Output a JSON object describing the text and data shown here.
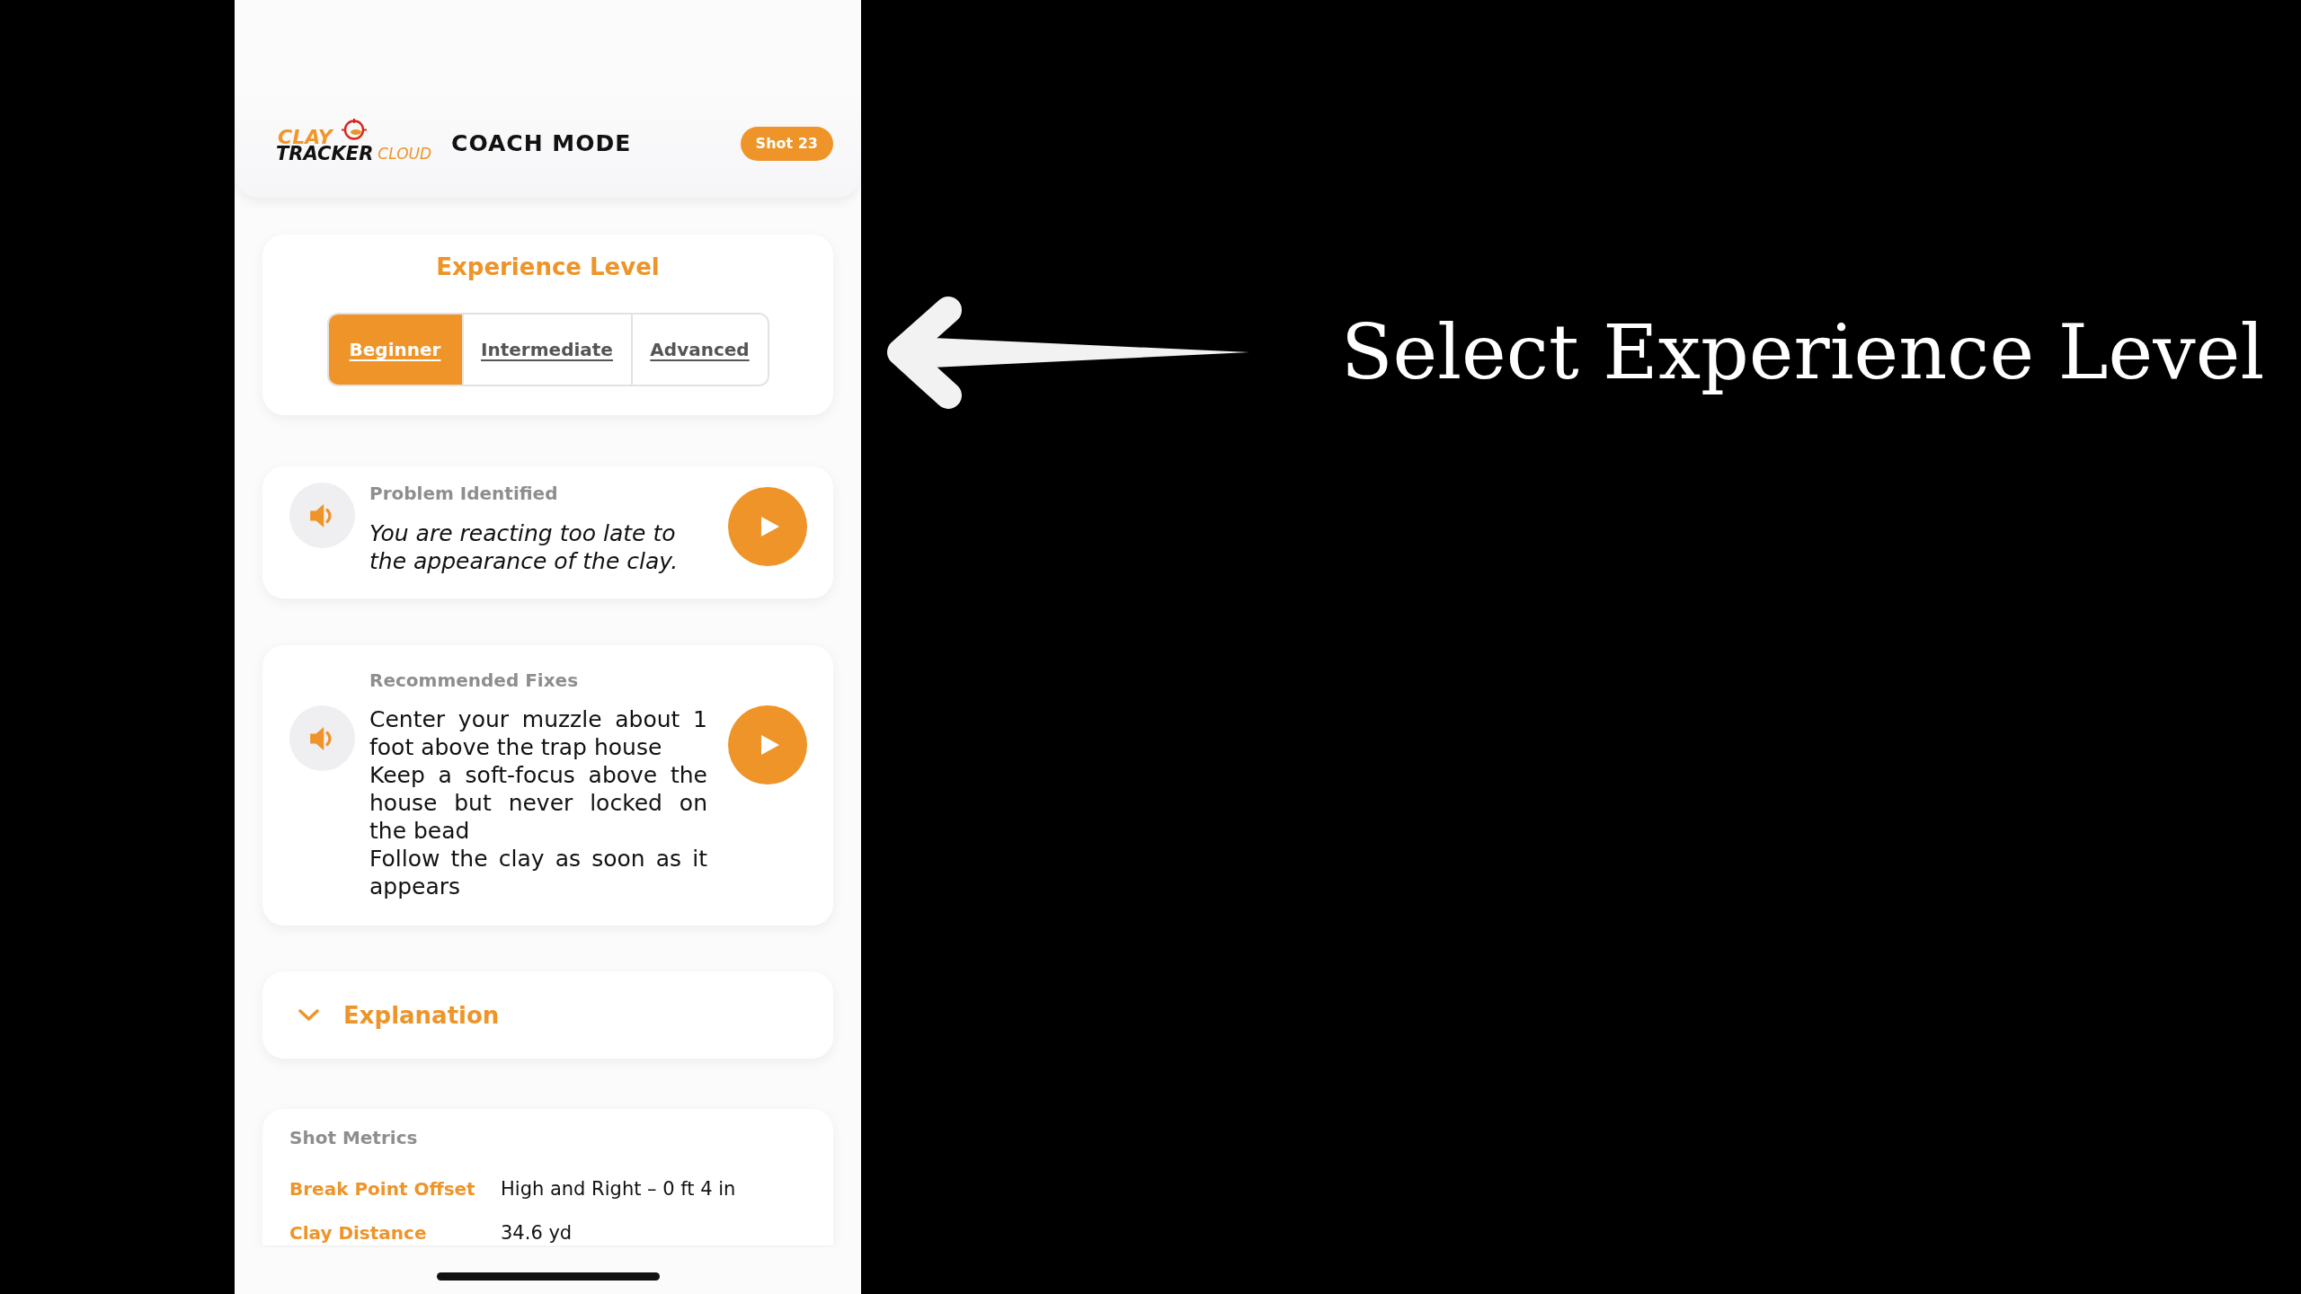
{
  "header": {
    "logo": {
      "line_1": "CLAY",
      "line_2": "TRACKER",
      "suffix": "CLOUD"
    },
    "title": "COACH MODE",
    "badge": "Shot 23"
  },
  "experience": {
    "title": "Experience Level",
    "levels": [
      {
        "label": "Beginner",
        "selected": true
      },
      {
        "label": "Intermediate",
        "selected": false
      },
      {
        "label": "Advanced",
        "selected": false
      }
    ]
  },
  "problem": {
    "label": "Problem Identified",
    "text": "You are reacting too late to the appearance of the clay."
  },
  "fixes": {
    "label": "Recommended Fixes",
    "items": [
      "Center your muzzle about 1 foot above the trap house",
      "Keep a soft-focus above the house but never locked on the bead",
      "Follow the clay as soon as it appears"
    ]
  },
  "explanation": {
    "title": "Explanation",
    "expanded": false
  },
  "shot_metrics": {
    "title": "Shot Metrics",
    "rows": [
      {
        "label": "Break Point Offset",
        "value": "High and Right – 0 ft 4 in"
      },
      {
        "label": "Clay Distance",
        "value": "34.6 yd"
      }
    ]
  },
  "callout": {
    "text": "Select Experience Level"
  }
}
